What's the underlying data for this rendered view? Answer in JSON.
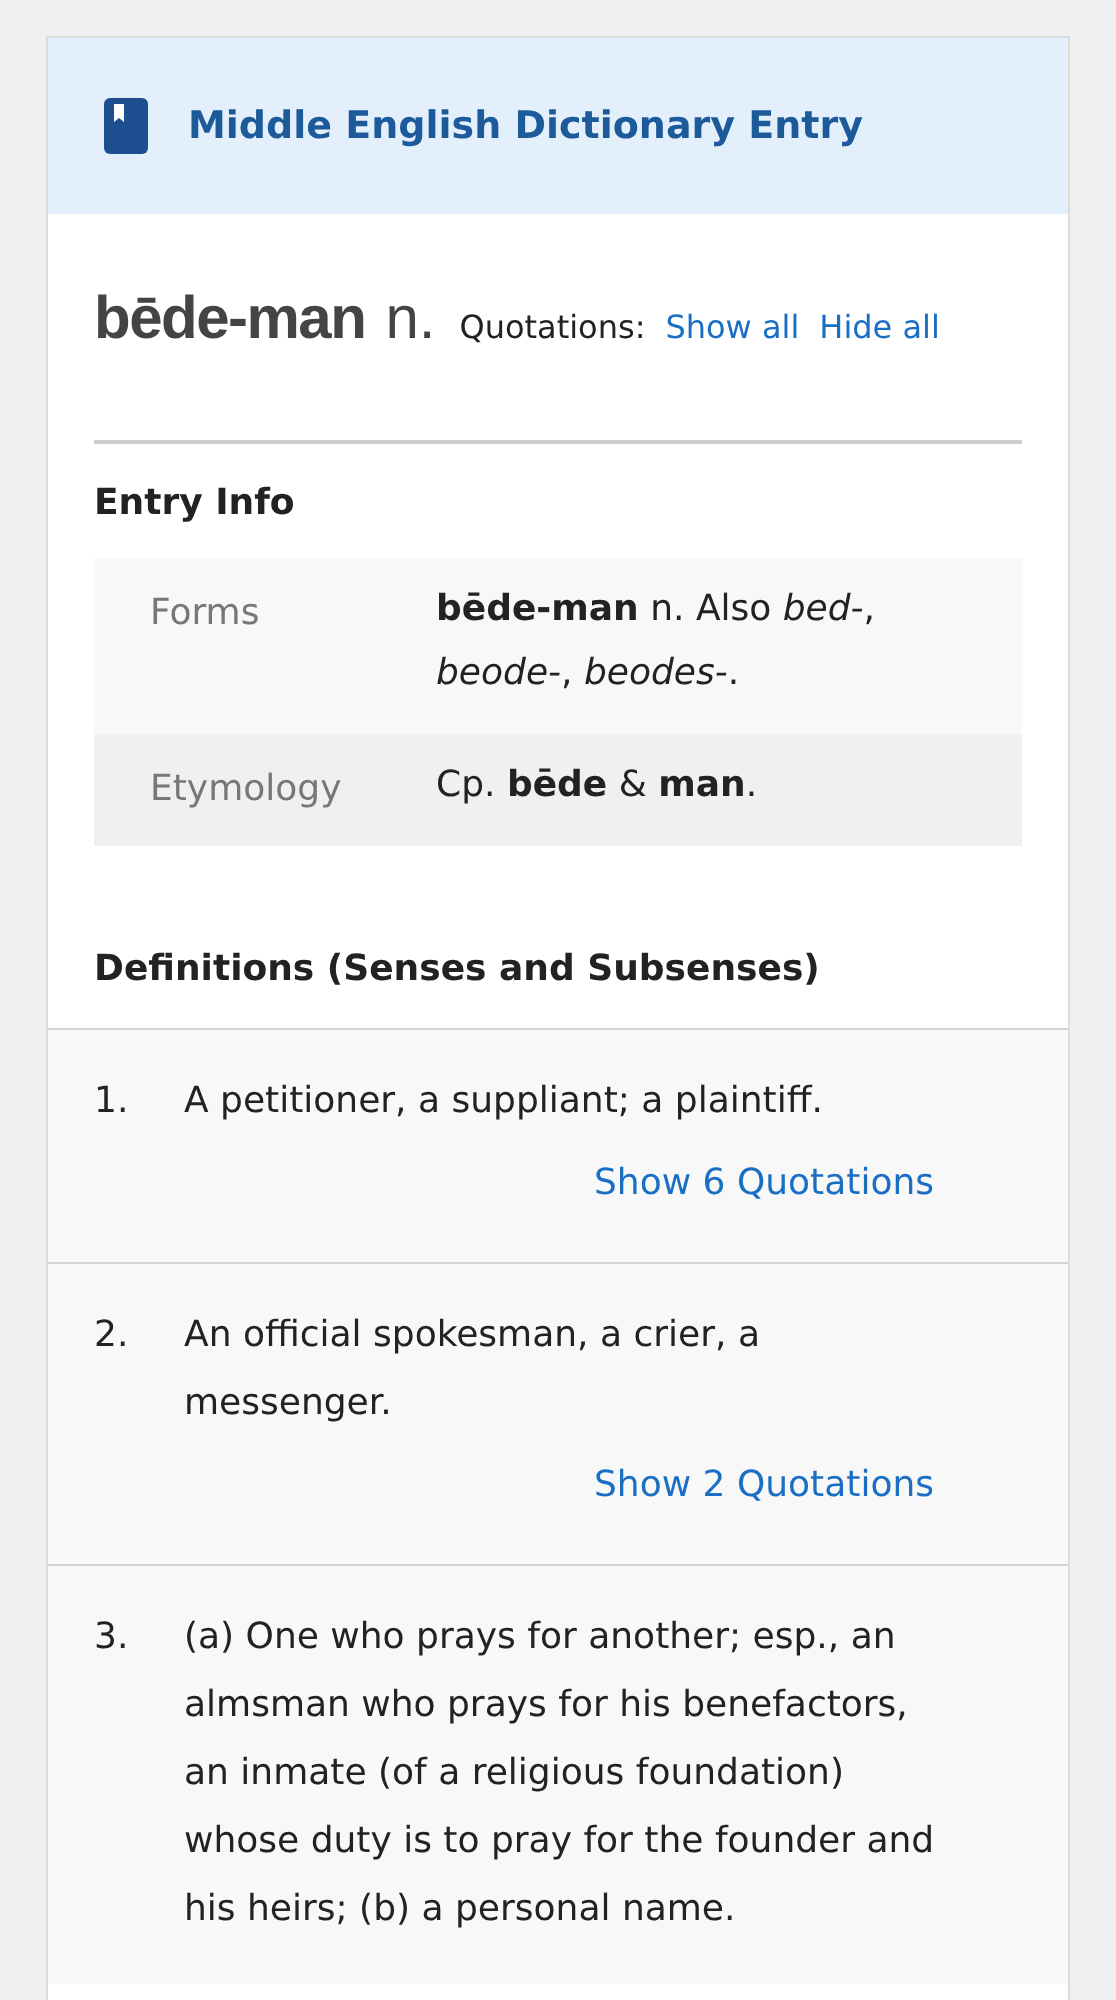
{
  "header": {
    "title": "Middle English Dictionary Entry"
  },
  "headword": {
    "word": "bēde-man",
    "pos": "n.",
    "quotations_label": "Quotations:",
    "links": [
      "Show all",
      "Hide all"
    ]
  },
  "entry_info": {
    "title": "Entry Info",
    "rows": [
      {
        "label": "Forms",
        "value": "**bēde-man** n. Also *bed-*, *beode-*, *beodes-*."
      },
      {
        "label": "Etymology",
        "value": "Cp. **bēde** & **man**."
      }
    ]
  },
  "definitions": {
    "title": "Definitions (Senses and Subsenses)",
    "senses": [
      {
        "number": "1.",
        "text": "A petitioner, a suppliant; a plaintiff.",
        "quotations_link": "Show 6 Quotations"
      },
      {
        "number": "2.",
        "text": "An official spokesman, a crier, a messenger.",
        "quotations_link": "Show 2 Quotations"
      },
      {
        "number": "3.",
        "text": "(a) One who prays for another; esp., an almsman who prays for his benefactors, an inmate (of a religious foundation) whose duty is to pray for the founder and his heirs; (b) a personal name."
      }
    ]
  }
}
